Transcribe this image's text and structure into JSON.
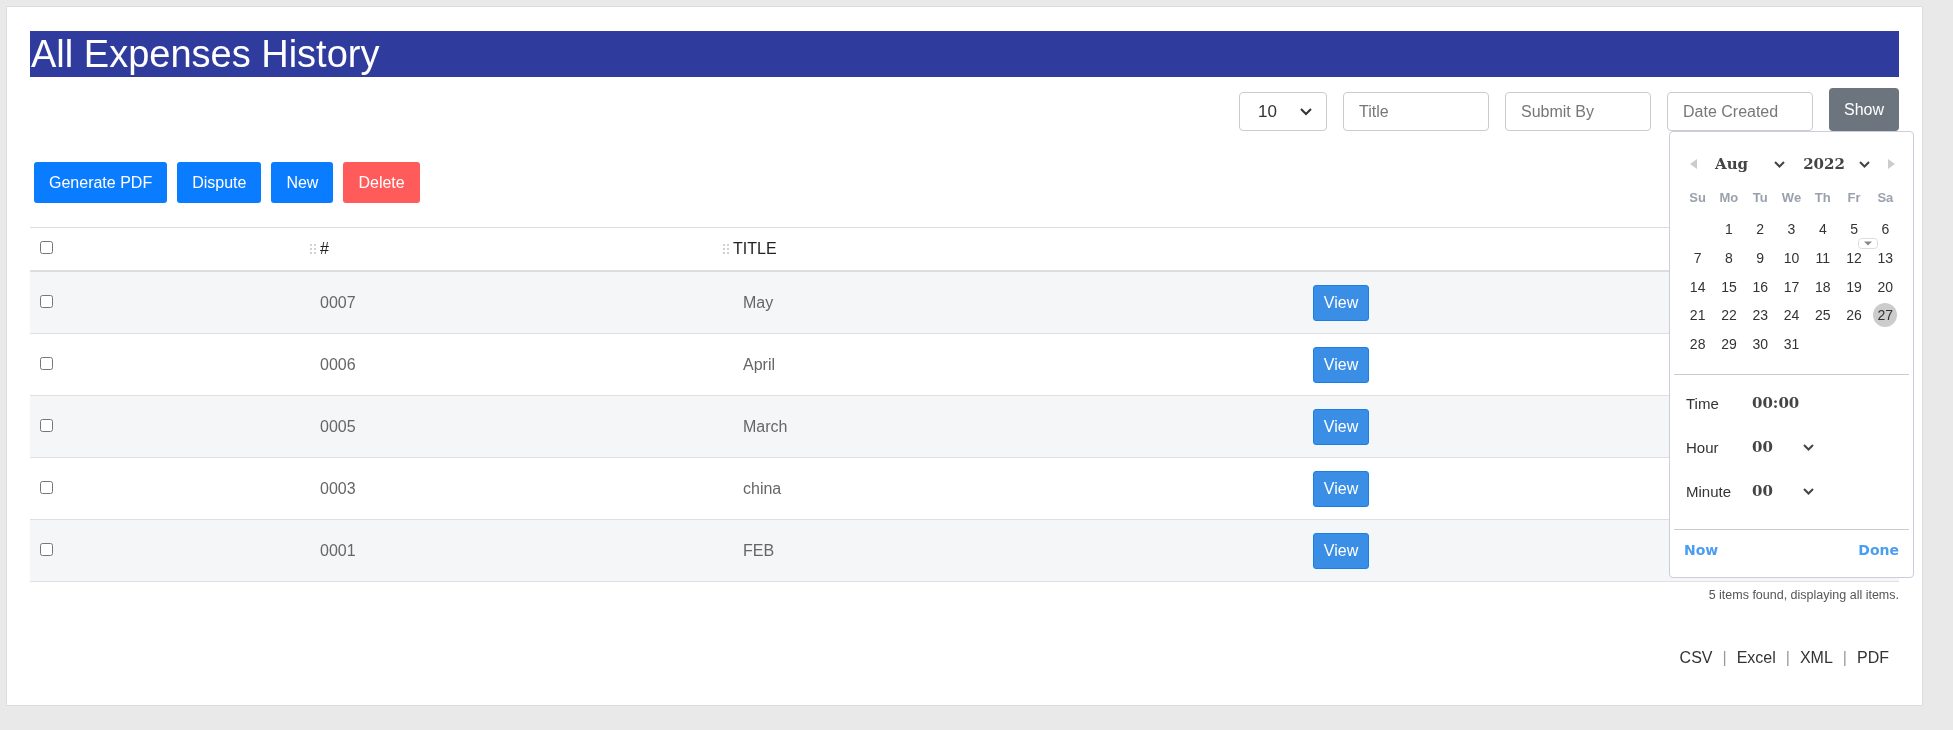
{
  "title": "All Expenses History",
  "filters": {
    "page_size": "10",
    "title_placeholder": "Title",
    "submit_by_placeholder": "Submit By",
    "date_created_placeholder": "Date Created",
    "show_button": "Show"
  },
  "actions": [
    {
      "label": "Generate PDF",
      "kind": "primary"
    },
    {
      "label": "Dispute",
      "kind": "primary"
    },
    {
      "label": "New",
      "kind": "primary"
    },
    {
      "label": "Delete",
      "kind": "danger"
    }
  ],
  "table": {
    "select_all_checked": false,
    "columns": [
      "#",
      "TITLE"
    ],
    "rows": [
      {
        "checked": false,
        "number": "0007",
        "title": "May",
        "action": "View"
      },
      {
        "checked": false,
        "number": "0006",
        "title": "April",
        "action": "View"
      },
      {
        "checked": false,
        "number": "0005",
        "title": "March",
        "action": "View"
      },
      {
        "checked": false,
        "number": "0003",
        "title": "china",
        "action": "View"
      },
      {
        "checked": false,
        "number": "0001",
        "title": "FEB",
        "action": "View"
      }
    ]
  },
  "calendar": {
    "month": "Aug",
    "year": "2022",
    "weekdays": [
      "Su",
      "Mo",
      "Tu",
      "We",
      "Th",
      "Fr",
      "Sa"
    ],
    "weeks": [
      {
        "kind": "partial",
        "days": [
          {
            "day": "1",
            "selected": false
          },
          {
            "day": "2",
            "selected": false
          },
          {
            "day": "3",
            "selected": false
          },
          {
            "day": "4",
            "selected": false
          },
          {
            "day": "5",
            "selected": false
          },
          {
            "day": "6",
            "selected": false
          }
        ]
      },
      {
        "kind": "full",
        "days": [
          {
            "day": "7",
            "selected": false
          },
          {
            "day": "8",
            "selected": false
          },
          {
            "day": "9",
            "selected": false
          },
          {
            "day": "10",
            "selected": false
          },
          {
            "day": "11",
            "selected": false
          },
          {
            "day": "12",
            "selected": false
          },
          {
            "day": "13",
            "selected": false
          }
        ]
      },
      {
        "kind": "full",
        "days": [
          {
            "day": "14",
            "selected": false
          },
          {
            "day": "15",
            "selected": false
          },
          {
            "day": "16",
            "selected": false
          },
          {
            "day": "17",
            "selected": false
          },
          {
            "day": "18",
            "selected": false
          },
          {
            "day": "19",
            "selected": false
          },
          {
            "day": "20",
            "selected": false
          }
        ]
      },
      {
        "kind": "full",
        "days": [
          {
            "day": "21",
            "selected": false
          },
          {
            "day": "22",
            "selected": false
          },
          {
            "day": "23",
            "selected": false
          },
          {
            "day": "24",
            "selected": false
          },
          {
            "day": "25",
            "selected": false
          },
          {
            "day": "26",
            "selected": false
          },
          {
            "day": "27",
            "selected": true
          }
        ]
      },
      {
        "kind": "full",
        "days": [
          {
            "day": "28",
            "selected": false
          },
          {
            "day": "29",
            "selected": false
          },
          {
            "day": "30",
            "selected": false
          },
          {
            "day": "31",
            "selected": false
          }
        ]
      }
    ],
    "time_label": "Time",
    "time_value": "00:00",
    "hour_label": "Hour",
    "hour_value": "00",
    "minute_label": "Minute",
    "minute_value": "00",
    "now_button": "Now",
    "done_button": "Done"
  },
  "summary": "5 items found, displaying all items.",
  "exports": [
    "CSV",
    "Excel",
    "XML",
    "PDF"
  ],
  "export_separator": "|"
}
